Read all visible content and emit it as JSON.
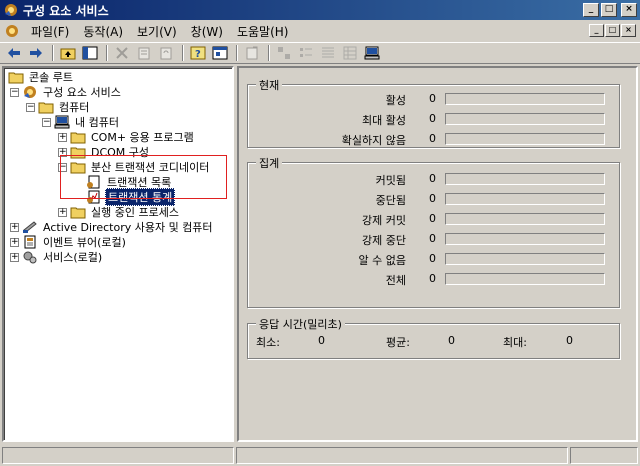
{
  "window": {
    "title": "구성 요소 서비스",
    "buttons": {
      "minimize": "_",
      "maximize": "□",
      "close": "×"
    }
  },
  "menu": {
    "items": [
      "파일(F)",
      "동작(A)",
      "보기(V)",
      "창(W)",
      "도움말(H)"
    ]
  },
  "toolbar": {
    "icons": [
      "back-arrow-icon",
      "forward-arrow-icon",
      "up-folder-icon",
      "show-hide-tree-icon",
      "delete-icon",
      "properties-icon",
      "refresh-icon",
      "help-icon",
      "mmc-icon",
      "new-window-icon",
      "view-large-icon",
      "view-small-icon",
      "view-list-icon",
      "view-detail-icon",
      "computer-icon"
    ]
  },
  "tree": {
    "items": [
      {
        "label": "콘솔 루트"
      },
      {
        "label": "구성 요소 서비스"
      },
      {
        "label": "컴퓨터"
      },
      {
        "label": "내 컴퓨터"
      },
      {
        "label": "COM+ 응용 프로그램"
      },
      {
        "label": "DCOM 구성"
      },
      {
        "label": "분산 트랜잭션 코디네이터"
      },
      {
        "label": "트랜잭션 목록"
      },
      {
        "label": "트랜잭션 통계"
      },
      {
        "label": "실행 중인 프로세스"
      },
      {
        "label": "Active Directory 사용자 및 컴퓨터"
      },
      {
        "label": "이벤트 뷰어(로컬)"
      },
      {
        "label": "서비스(로컬)"
      }
    ]
  },
  "current": {
    "title": "현재",
    "rows": [
      {
        "label": "활성",
        "value": "0"
      },
      {
        "label": "최대 활성",
        "value": "0"
      },
      {
        "label": "확실하지 않음",
        "value": "0"
      }
    ]
  },
  "aggregate": {
    "title": "집계",
    "rows": [
      {
        "label": "커밋됨",
        "value": "0"
      },
      {
        "label": "중단됨",
        "value": "0"
      },
      {
        "label": "강제 커밋",
        "value": "0"
      },
      {
        "label": "강제 중단",
        "value": "0"
      },
      {
        "label": "알 수 없음",
        "value": "0"
      },
      {
        "label": "전체",
        "value": "0"
      }
    ]
  },
  "response_time": {
    "title": "응답 시간(밀리초)",
    "min_label": "최소:",
    "min_value": "0",
    "avg_label": "평균:",
    "avg_value": "0",
    "max_label": "최대:",
    "max_value": "0"
  },
  "colors": {
    "titlebar_start": "#0a246a",
    "titlebar_end": "#3a6ea5",
    "selection": "#0a246a",
    "highlight_box": "#e02020",
    "face": "#d4d0c8"
  }
}
